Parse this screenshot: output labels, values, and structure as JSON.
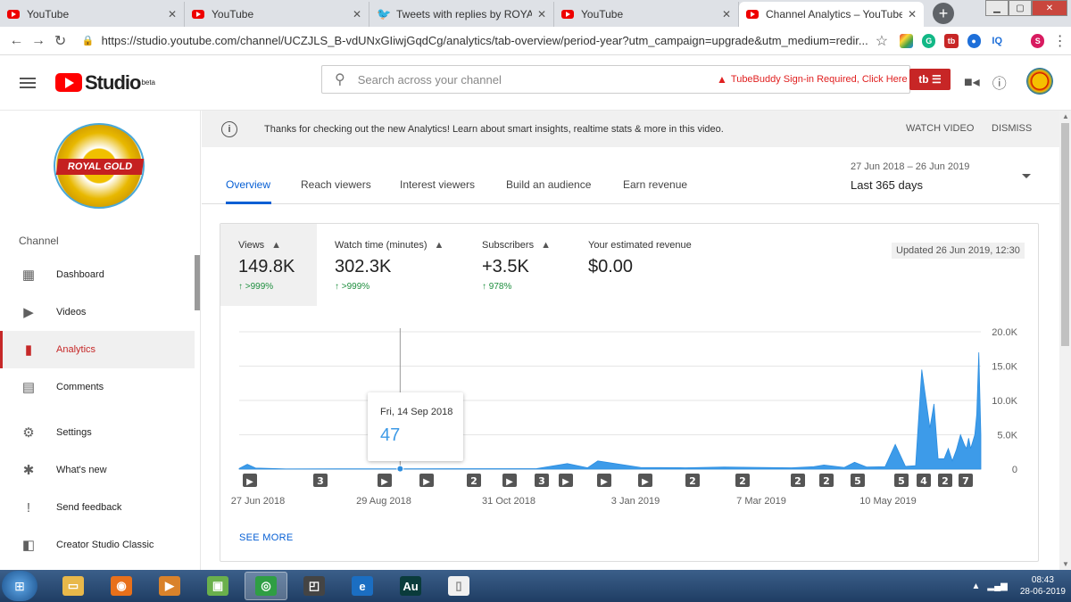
{
  "browser": {
    "tabs": [
      {
        "title": "YouTube",
        "icon": "youtube-icon",
        "active": false
      },
      {
        "title": "YouTube",
        "icon": "youtube-icon",
        "active": false
      },
      {
        "title": "Tweets with replies by ROYAL G",
        "icon": "twitter-icon",
        "active": false
      },
      {
        "title": "YouTube",
        "icon": "youtube-icon",
        "active": false
      },
      {
        "title": "Channel Analytics – YouTube St",
        "icon": "youtube-icon",
        "active": true
      }
    ],
    "url": "https://studio.youtube.com/channel/UCZJLS_B-vdUNxGIiwjGqdCg/analytics/tab-overview/period-year?utm_campaign=upgrade&utm_medium=redir...",
    "extensions": [
      "IQ",
      "S"
    ]
  },
  "header": {
    "logo_text": "Studio",
    "logo_badge": "beta",
    "search_placeholder": "Search across your channel",
    "tubebuddy_warning": "TubeBuddy Sign-in Required, Click Here",
    "tubebuddy_btn": "tb ☰"
  },
  "sidebar": {
    "channel_label": "Channel",
    "channel_logo_text": "ROYAL GOLD",
    "items": [
      {
        "label": "Dashboard",
        "icon": "dashboard-icon",
        "glyph": "▦"
      },
      {
        "label": "Videos",
        "icon": "videos-icon",
        "glyph": "▶"
      },
      {
        "label": "Analytics",
        "icon": "analytics-icon",
        "glyph": "▮",
        "active": true
      },
      {
        "label": "Comments",
        "icon": "comments-icon",
        "glyph": "▤"
      },
      {
        "label": "Settings",
        "icon": "settings-icon",
        "glyph": "⚙"
      },
      {
        "label": "What's new",
        "icon": "whats-new-icon",
        "glyph": "✱"
      },
      {
        "label": "Send feedback",
        "icon": "feedback-icon",
        "glyph": "!"
      },
      {
        "label": "Creator Studio Classic",
        "icon": "classic-icon",
        "glyph": "◧"
      }
    ]
  },
  "banner": {
    "message": "Thanks for checking out the new Analytics! Learn about smart insights, realtime stats & more in this video.",
    "watch_video": "WATCH VIDEO",
    "dismiss": "DISMISS"
  },
  "analytics_tabs": [
    "Overview",
    "Reach viewers",
    "Interest viewers",
    "Build an audience",
    "Earn revenue"
  ],
  "date_range": "27 Jun 2018 – 26 Jun 2019",
  "period": "Last 365 days",
  "metrics": [
    {
      "label": "Views",
      "value": "149.8K",
      "change": "↑ >999%",
      "warn": true
    },
    {
      "label": "Watch time (minutes)",
      "value": "302.3K",
      "change": "↑ >999%",
      "warn": true
    },
    {
      "label": "Subscribers",
      "value": "+3.5K",
      "change": "↑ 978%",
      "warn": true
    },
    {
      "label": "Your estimated revenue",
      "value": "$0.00",
      "change": "",
      "warn": false
    }
  ],
  "updated": "Updated 26 Jun 2019, 12:30",
  "tooltip": {
    "date": "Fri, 14 Sep 2018",
    "value": "47"
  },
  "see_more": "SEE MORE",
  "chart_data": {
    "type": "area",
    "title": "",
    "xlabel": "",
    "ylabel": "",
    "x_tick_labels": [
      "27 Jun 2018",
      "29 Aug 2018",
      "31 Oct 2018",
      "3 Jan 2019",
      "7 Mar 2019",
      "10 May 2019"
    ],
    "y_tick_labels": [
      "0",
      "5.0K",
      "10.0K",
      "15.0K",
      "20.0K"
    ],
    "ylim": [
      0,
      20000
    ],
    "grid": true,
    "series": [
      {
        "x": [
          "2018-06-27",
          "2018-07-01",
          "2018-07-05",
          "2018-07-20",
          "2018-08-15",
          "2018-09-14",
          "2018-10-15",
          "2018-11-20",
          "2018-12-05",
          "2018-12-15",
          "2018-12-20",
          "2019-01-10",
          "2019-02-01",
          "2019-02-20",
          "2019-03-10",
          "2019-03-25",
          "2019-04-05",
          "2019-04-10",
          "2019-04-20",
          "2019-04-25",
          "2019-05-01",
          "2019-05-10",
          "2019-05-15",
          "2019-05-20",
          "2019-05-25",
          "2019-05-28",
          "2019-06-01",
          "2019-06-03",
          "2019-06-05",
          "2019-06-08",
          "2019-06-10",
          "2019-06-12",
          "2019-06-14",
          "2019-06-16",
          "2019-06-18",
          "2019-06-19",
          "2019-06-20",
          "2019-06-21",
          "2019-06-22",
          "2019-06-23",
          "2019-06-24",
          "2019-06-25",
          "2019-06-26"
        ],
        "values": [
          100,
          700,
          150,
          30,
          40,
          47,
          60,
          80,
          800,
          200,
          1200,
          250,
          200,
          300,
          250,
          200,
          350,
          600,
          250,
          1000,
          300,
          350,
          3600,
          400,
          500,
          14500,
          6000,
          9500,
          1500,
          1500,
          3000,
          1200,
          2800,
          5000,
          3500,
          3000,
          4500,
          3000,
          4000,
          5000,
          8000,
          17000,
          5000
        ]
      }
    ],
    "video_markers": [
      "▶",
      "3",
      "▶",
      "▶",
      "2",
      "▶",
      "3",
      "▶",
      "▶",
      "▶",
      "2",
      "2",
      "2",
      "2",
      "5",
      "5",
      "4",
      "2",
      "7"
    ]
  },
  "taskbar": {
    "clock_time": "08:43",
    "clock_date": "28-06-2019",
    "apps": [
      {
        "name": "file-explorer-icon",
        "glyph": "▭",
        "color": "#e8b84a"
      },
      {
        "name": "firefox-icon",
        "glyph": "◉",
        "color": "#e8701a"
      },
      {
        "name": "media-player-icon",
        "glyph": "▶",
        "color": "#d9822b"
      },
      {
        "name": "photos-icon",
        "glyph": "▣",
        "color": "#6ab04c"
      },
      {
        "name": "chrome-icon",
        "glyph": "◎",
        "color": "#2f9e44"
      },
      {
        "name": "snipping-tool-icon",
        "glyph": "◰",
        "color": "#444444"
      },
      {
        "name": "internet-explorer-icon",
        "glyph": "e",
        "color": "#1b6ec2"
      },
      {
        "name": "audition-icon",
        "glyph": "Au",
        "color": "#0a3b3b"
      },
      {
        "name": "notepad-icon",
        "glyph": "▯",
        "color": "#f0f0f0"
      }
    ]
  }
}
